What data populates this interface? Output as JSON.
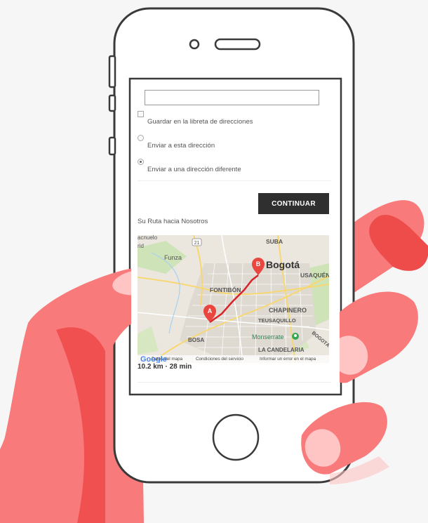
{
  "form": {
    "address_value": "",
    "options": [
      {
        "label": "Guardar en la libreta de direcciones",
        "type": "checkbox",
        "checked": false
      },
      {
        "label": "Enviar a esta dirección",
        "type": "radio",
        "checked": false
      },
      {
        "label": "Enviar a una dirección diferente",
        "type": "radio",
        "checked": true
      }
    ],
    "continue_label": "CONTINUAR"
  },
  "route": {
    "title": "Su Ruta hacia Nosotros",
    "summary": "10.2 km · 28 min"
  },
  "map": {
    "places": {
      "suba": "SUBA",
      "bogota": "Bogotá",
      "usaquen": "USAQUÉN",
      "funza": "Funza",
      "fontibon": "FONTIBÓN",
      "chapinero": "CHAPINERO",
      "teusaquillo": "TEUSAQUILLO",
      "monserrate": "Monserrate",
      "bosa": "BOSA",
      "la_candelaria": "LA CANDELARIA",
      "bogota_edge": "BOGOTÁ",
      "acnuelo": "acnuelo",
      "rid": "rid",
      "route_number": "21"
    },
    "markers": {
      "a": "A",
      "b": "B"
    },
    "footer": {
      "logo": "Google",
      "data": "Datos del mapa",
      "terms": "Condiciones del servicio",
      "report": "Informar un error en el mapa"
    }
  },
  "colors": {
    "hand": "#f97a7a",
    "hand_shadow": "#ee4b4b",
    "nail": "#ffc4c4",
    "phone_outline": "#3a3a3a",
    "button": "#2f2f2f",
    "marker": "#e8463e",
    "route_line": "#d8232a"
  }
}
